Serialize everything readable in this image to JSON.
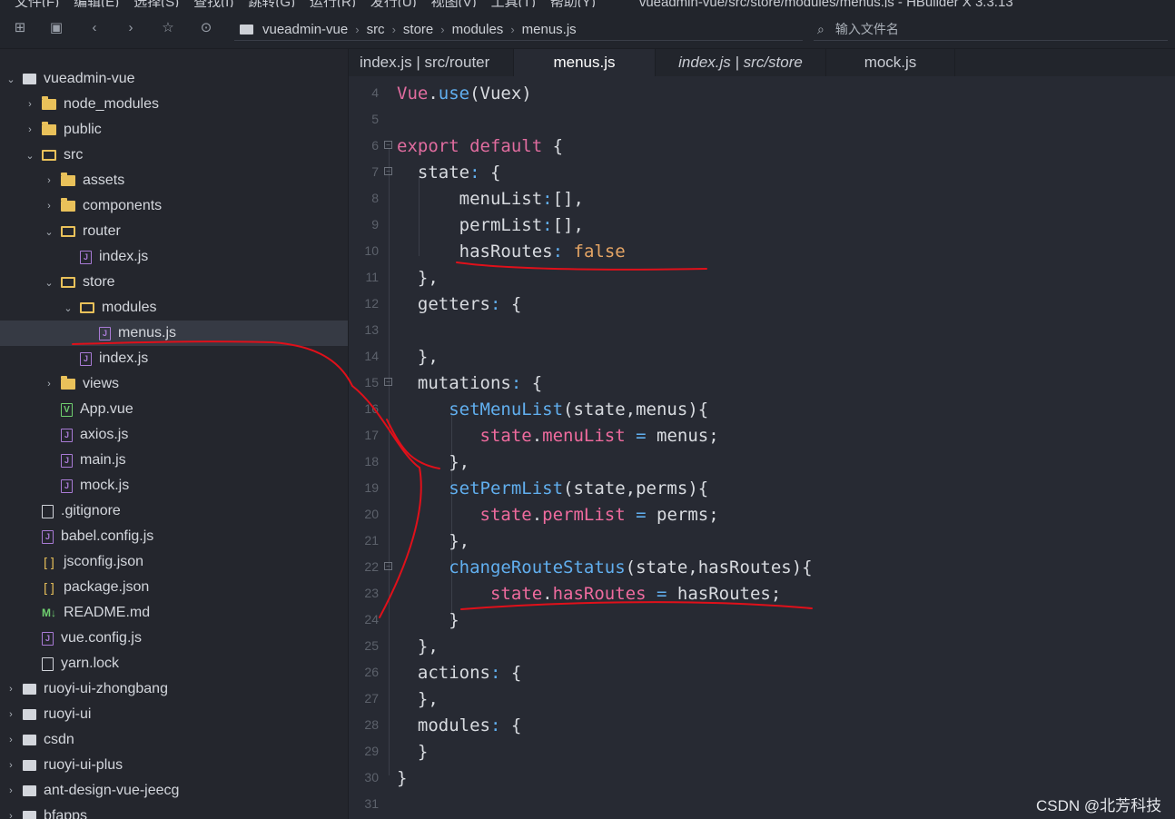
{
  "menubar": {
    "items": [
      "文件(F)",
      "编辑(E)",
      "选择(S)",
      "查找(I)",
      "跳转(G)",
      "运行(R)",
      "发行(U)",
      "视图(V)",
      "工具(T)",
      "帮助(Y)"
    ],
    "window_title": "vueadmin-vue/src/store/modules/menus.js - HBuilder X 3.3.13"
  },
  "toolbar": {
    "icons": [
      "new-file-icon",
      "save-icon",
      "back-icon",
      "forward-icon",
      "star-icon",
      "run-icon"
    ],
    "breadcrumb": [
      "vueadmin-vue",
      "src",
      "store",
      "modules",
      "menus.js"
    ],
    "file_search_placeholder": "输入文件名"
  },
  "sidebar": {
    "items": [
      {
        "label": "vueadmin-vue",
        "icon": "project-icon",
        "twisty": "open",
        "depth": 0
      },
      {
        "label": "node_modules",
        "icon": "folder-icon",
        "twisty": "closed",
        "depth": 1
      },
      {
        "label": "public",
        "icon": "folder-icon",
        "twisty": "closed",
        "depth": 1
      },
      {
        "label": "src",
        "icon": "folder-open-icon",
        "twisty": "open",
        "depth": 1
      },
      {
        "label": "assets",
        "icon": "folder-icon",
        "twisty": "closed",
        "depth": 2
      },
      {
        "label": "components",
        "icon": "folder-icon",
        "twisty": "closed",
        "depth": 2
      },
      {
        "label": "router",
        "icon": "folder-open-icon",
        "twisty": "open",
        "depth": 2
      },
      {
        "label": "index.js",
        "icon": "js-file-icon",
        "twisty": "none",
        "depth": 3
      },
      {
        "label": "store",
        "icon": "folder-open-icon",
        "twisty": "open",
        "depth": 2
      },
      {
        "label": "modules",
        "icon": "folder-open-icon",
        "twisty": "open",
        "depth": 3
      },
      {
        "label": "menus.js",
        "icon": "js-file-icon",
        "twisty": "none",
        "depth": 4,
        "selected": true
      },
      {
        "label": "index.js",
        "icon": "js-file-icon",
        "twisty": "none",
        "depth": 3
      },
      {
        "label": "views",
        "icon": "folder-icon",
        "twisty": "closed",
        "depth": 2
      },
      {
        "label": "App.vue",
        "icon": "vue-file-icon",
        "twisty": "none",
        "depth": 2
      },
      {
        "label": "axios.js",
        "icon": "js-file-icon",
        "twisty": "none",
        "depth": 2
      },
      {
        "label": "main.js",
        "icon": "js-file-icon",
        "twisty": "none",
        "depth": 2
      },
      {
        "label": "mock.js",
        "icon": "js-file-icon",
        "twisty": "none",
        "depth": 2
      },
      {
        "label": ".gitignore",
        "icon": "text-file-icon",
        "twisty": "none",
        "depth": 1
      },
      {
        "label": "babel.config.js",
        "icon": "js-file-icon",
        "twisty": "none",
        "depth": 1
      },
      {
        "label": "jsconfig.json",
        "icon": "json-file-icon",
        "twisty": "none",
        "depth": 1
      },
      {
        "label": "package.json",
        "icon": "json-file-icon",
        "twisty": "none",
        "depth": 1
      },
      {
        "label": "README.md",
        "icon": "markdown-file-icon",
        "twisty": "none",
        "depth": 1
      },
      {
        "label": "vue.config.js",
        "icon": "js-file-icon",
        "twisty": "none",
        "depth": 1
      },
      {
        "label": "yarn.lock",
        "icon": "text-file-icon",
        "twisty": "none",
        "depth": 1
      },
      {
        "label": "ruoyi-ui-zhongbang",
        "icon": "project-icon",
        "twisty": "closed",
        "depth": 0
      },
      {
        "label": "ruoyi-ui",
        "icon": "project-icon",
        "twisty": "closed",
        "depth": 0
      },
      {
        "label": "csdn",
        "icon": "project-icon",
        "twisty": "closed",
        "depth": 0
      },
      {
        "label": "ruoyi-ui-plus",
        "icon": "project-icon",
        "twisty": "closed",
        "depth": 0
      },
      {
        "label": "ant-design-vue-jeecg",
        "icon": "project-icon",
        "twisty": "closed",
        "depth": 0
      },
      {
        "label": "bfapps",
        "icon": "project-icon",
        "twisty": "closed",
        "depth": 0
      }
    ]
  },
  "tabs": [
    {
      "label": "index.js | src/router",
      "active": false,
      "italic": false
    },
    {
      "label": "menus.js",
      "active": true,
      "italic": false
    },
    {
      "label": "index.js | src/store",
      "active": false,
      "italic": true
    },
    {
      "label": "mock.js",
      "active": false,
      "italic": false
    }
  ],
  "editor": {
    "lines": [
      {
        "n": "4",
        "fold": false,
        "tokens": [
          [
            "kw",
            "Vue"
          ],
          [
            "punct",
            "."
          ],
          [
            "fn",
            "use"
          ],
          [
            "punct",
            "(Vuex)"
          ]
        ]
      },
      {
        "n": "5",
        "fold": false,
        "tokens": []
      },
      {
        "n": "6",
        "fold": true,
        "tokens": [
          [
            "kw",
            "export"
          ],
          [
            "punct",
            " "
          ],
          [
            "kw",
            "default"
          ],
          [
            "punct",
            " {"
          ]
        ]
      },
      {
        "n": "7",
        "fold": true,
        "tokens": [
          [
            "punct",
            "  state"
          ],
          [
            "fn",
            ":"
          ],
          [
            "punct",
            " {"
          ]
        ]
      },
      {
        "n": "8",
        "fold": false,
        "tokens": [
          [
            "punct",
            "      menuList"
          ],
          [
            "fn",
            ":"
          ],
          [
            "punct",
            "[],"
          ]
        ]
      },
      {
        "n": "9",
        "fold": false,
        "tokens": [
          [
            "punct",
            "      permList"
          ],
          [
            "fn",
            ":"
          ],
          [
            "punct",
            "[],"
          ]
        ]
      },
      {
        "n": "10",
        "fold": false,
        "tokens": [
          [
            "punct",
            "      hasRoutes"
          ],
          [
            "fn",
            ":"
          ],
          [
            "punct",
            " "
          ],
          [
            "bool",
            "false"
          ]
        ]
      },
      {
        "n": "11",
        "fold": false,
        "tokens": [
          [
            "punct",
            "  },"
          ]
        ]
      },
      {
        "n": "12",
        "fold": false,
        "tokens": [
          [
            "punct",
            "  getters"
          ],
          [
            "fn",
            ":"
          ],
          [
            "punct",
            " {"
          ]
        ]
      },
      {
        "n": "13",
        "fold": false,
        "tokens": []
      },
      {
        "n": "14",
        "fold": false,
        "tokens": [
          [
            "punct",
            "  },"
          ]
        ]
      },
      {
        "n": "15",
        "fold": true,
        "tokens": [
          [
            "punct",
            "  mutations"
          ],
          [
            "fn",
            ":"
          ],
          [
            "punct",
            " {"
          ]
        ]
      },
      {
        "n": "16",
        "fold": false,
        "tokens": [
          [
            "punct",
            "     "
          ],
          [
            "fn",
            "setMenuList"
          ],
          [
            "punct",
            "(state,menus){"
          ]
        ]
      },
      {
        "n": "17",
        "fold": false,
        "tokens": [
          [
            "punct",
            "        "
          ],
          [
            "prop",
            "state"
          ],
          [
            "punct",
            "."
          ],
          [
            "prop",
            "menuList"
          ],
          [
            "punct",
            " "
          ],
          [
            "fn",
            "="
          ],
          [
            "punct",
            " menus;"
          ]
        ]
      },
      {
        "n": "18",
        "fold": false,
        "tokens": [
          [
            "punct",
            "     },"
          ]
        ]
      },
      {
        "n": "19",
        "fold": false,
        "tokens": [
          [
            "punct",
            "     "
          ],
          [
            "fn",
            "setPermList"
          ],
          [
            "punct",
            "(state,perms){"
          ]
        ]
      },
      {
        "n": "20",
        "fold": false,
        "tokens": [
          [
            "punct",
            "        "
          ],
          [
            "prop",
            "state"
          ],
          [
            "punct",
            "."
          ],
          [
            "prop",
            "permList"
          ],
          [
            "punct",
            " "
          ],
          [
            "fn",
            "="
          ],
          [
            "punct",
            " perms;"
          ]
        ]
      },
      {
        "n": "21",
        "fold": false,
        "tokens": [
          [
            "punct",
            "     },"
          ]
        ]
      },
      {
        "n": "22",
        "fold": true,
        "tokens": [
          [
            "punct",
            "     "
          ],
          [
            "fn",
            "changeRouteStatus"
          ],
          [
            "punct",
            "(state,hasRoutes){"
          ]
        ]
      },
      {
        "n": "23",
        "fold": false,
        "tokens": [
          [
            "punct",
            "         "
          ],
          [
            "prop",
            "state"
          ],
          [
            "punct",
            "."
          ],
          [
            "prop",
            "hasRoutes"
          ],
          [
            "punct",
            " "
          ],
          [
            "fn",
            "="
          ],
          [
            "punct",
            " hasRoutes;"
          ]
        ]
      },
      {
        "n": "24",
        "fold": false,
        "tokens": [
          [
            "punct",
            "     }"
          ]
        ]
      },
      {
        "n": "25",
        "fold": false,
        "tokens": [
          [
            "punct",
            "  },"
          ]
        ]
      },
      {
        "n": "26",
        "fold": false,
        "tokens": [
          [
            "punct",
            "  actions"
          ],
          [
            "fn",
            ":"
          ],
          [
            "punct",
            " {"
          ]
        ]
      },
      {
        "n": "27",
        "fold": false,
        "tokens": [
          [
            "punct",
            "  },"
          ]
        ]
      },
      {
        "n": "28",
        "fold": false,
        "tokens": [
          [
            "punct",
            "  modules"
          ],
          [
            "fn",
            ":"
          ],
          [
            "punct",
            " {"
          ]
        ]
      },
      {
        "n": "29",
        "fold": false,
        "tokens": [
          [
            "punct",
            "  }"
          ]
        ]
      },
      {
        "n": "30",
        "fold": false,
        "tokens": [
          [
            "punct",
            "}"
          ]
        ]
      },
      {
        "n": "31",
        "fold": false,
        "tokens": []
      }
    ]
  },
  "watermark": "CSDN @北芳科技",
  "colors": {
    "annotation": "#e0101a",
    "keyword": "#e06c9f",
    "function": "#61afef",
    "boolean": "#e5a565",
    "folder": "#e9c15a"
  }
}
